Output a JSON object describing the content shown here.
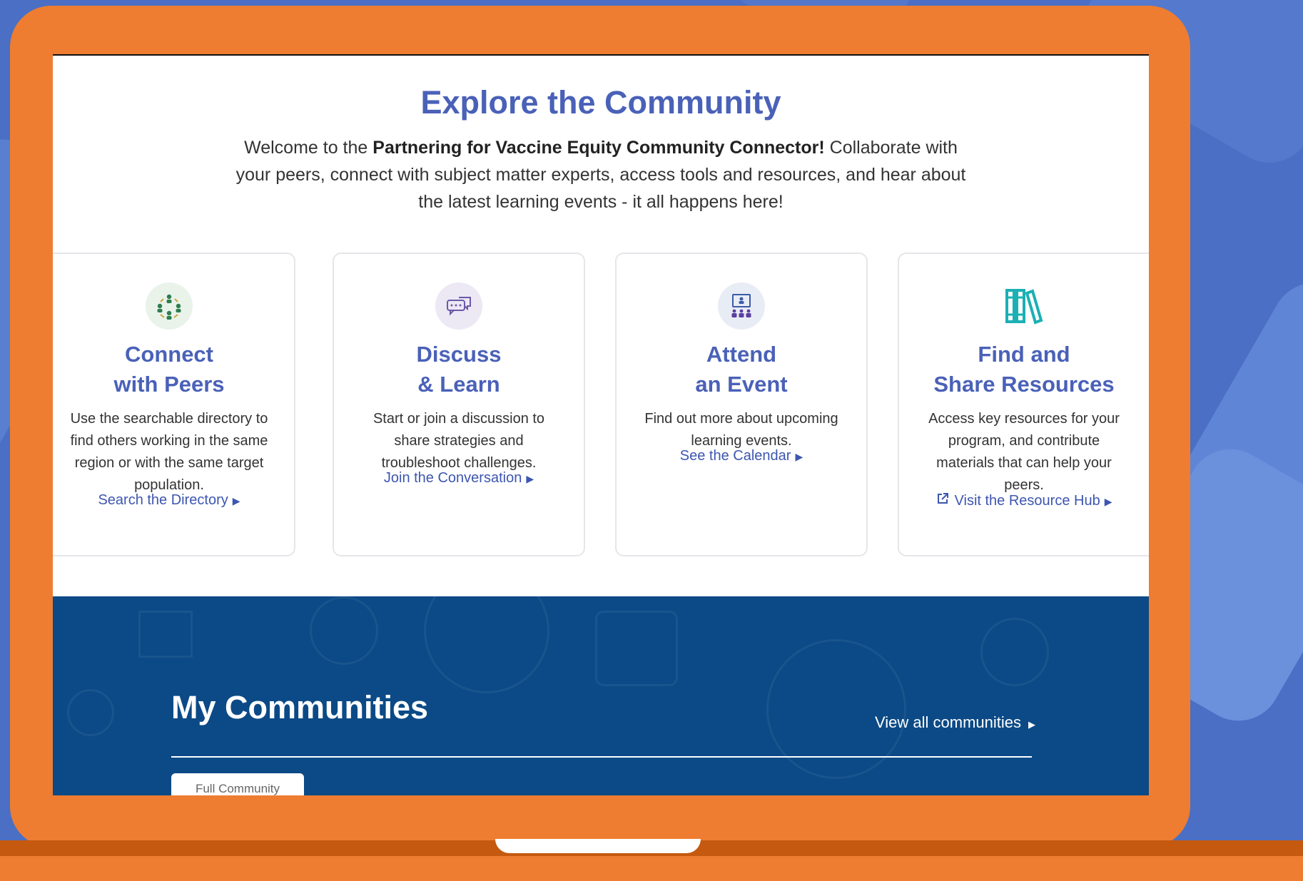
{
  "explore": {
    "heading": "Explore the Community",
    "intro_prefix": "Welcome to the ",
    "intro_bold": "Partnering for Vaccine Equity Community Connector!",
    "intro_suffix": " Collaborate with your peers, connect with subject matter experts, access tools and resources, and hear about the latest learning events - it all happens here!"
  },
  "cards": [
    {
      "icon": "connect-peers-icon",
      "title_line1": "Connect",
      "title_line2": "with Peers",
      "description": "Use the searchable directory to find others working in the same region or with the same target population.",
      "link": "Search the Directory"
    },
    {
      "icon": "discussion-bubbles-icon",
      "title_line1": "Discuss",
      "title_line2": "& Learn",
      "description": "Start or join a discussion to share strategies and troubleshoot challenges.",
      "link": "Join the Conversation"
    },
    {
      "icon": "presentation-event-icon",
      "title_line1": "Attend",
      "title_line2": "an Event",
      "description": "Find out more about upcoming learning events.",
      "link": "See the Calendar"
    },
    {
      "icon": "books-icon",
      "title_line1": "Find and",
      "title_line2": "Share Resources",
      "description": "Access key resources for your program, and contribute materials that can help your peers.",
      "link": "Visit the Resource Hub"
    }
  ],
  "my_communities": {
    "heading": "My Communities",
    "view_all": "View all communities",
    "tab": "Full Community"
  },
  "colors": {
    "accent": "#4a61b8",
    "laptop": "#ee7d31",
    "dark_section": "#0b4a86",
    "background": "#4a6fc4"
  }
}
